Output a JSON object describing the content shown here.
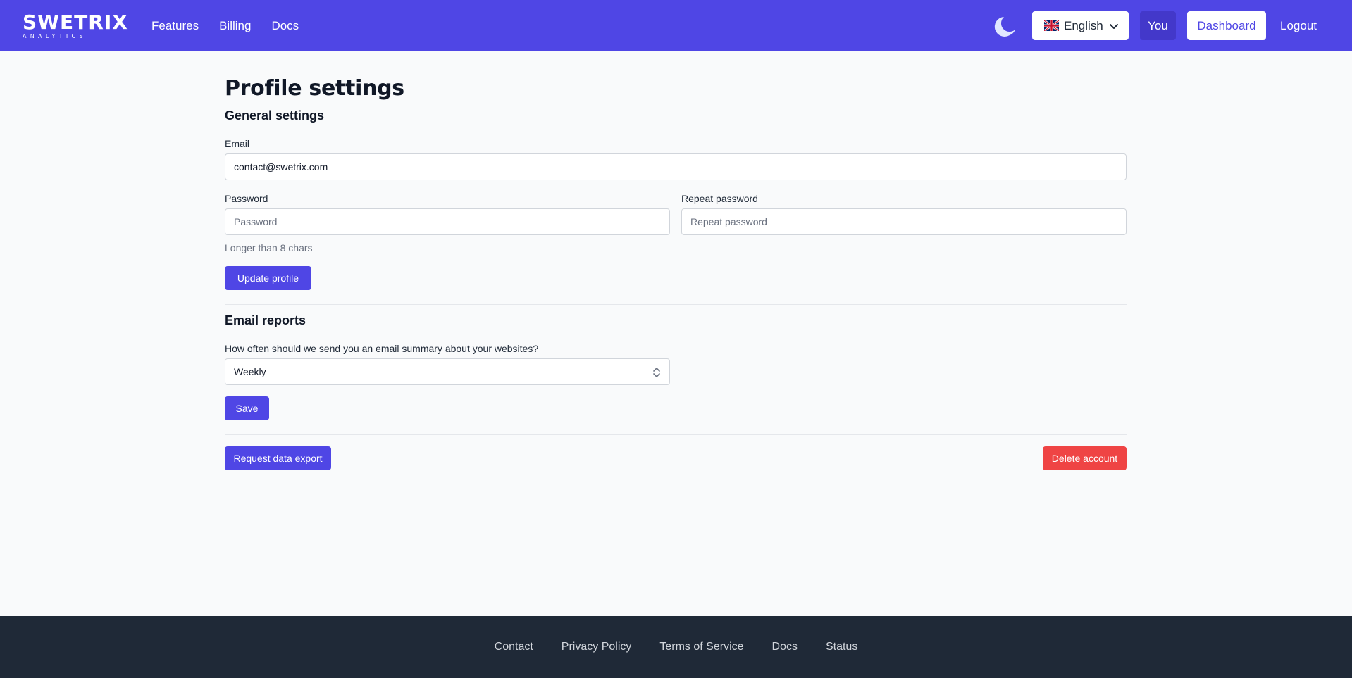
{
  "brand": {
    "name": "SWETRIX",
    "tagline": "ANALYTICS"
  },
  "header": {
    "nav": [
      {
        "label": "Features"
      },
      {
        "label": "Billing"
      },
      {
        "label": "Docs"
      }
    ],
    "language": {
      "selected": "English",
      "flag": "uk-flag-icon"
    },
    "you_label": "You",
    "dashboard_label": "Dashboard",
    "logout_label": "Logout",
    "theme_icon": "moon-icon"
  },
  "profile": {
    "title": "Profile settings",
    "general": {
      "title": "General settings",
      "email_label": "Email",
      "email_value": "contact@swetrix.com",
      "password_label": "Password",
      "password_placeholder": "Password",
      "repeat_label": "Repeat password",
      "repeat_placeholder": "Repeat password",
      "password_hint": "Longer than 8 chars",
      "update_button": "Update profile"
    },
    "reports": {
      "title": "Email reports",
      "question": "How often should we send you an email summary about your websites?",
      "selected": "Weekly",
      "save_button": "Save"
    },
    "export_button": "Request data export",
    "delete_button": "Delete account"
  },
  "footer": {
    "links": [
      {
        "label": "Contact"
      },
      {
        "label": "Privacy Policy"
      },
      {
        "label": "Terms of Service"
      },
      {
        "label": "Docs"
      },
      {
        "label": "Status"
      }
    ]
  },
  "colors": {
    "primary": "#4f46e5",
    "primary_dark": "#4338ca",
    "danger": "#ef4444",
    "footer_bg": "#1f2937",
    "page_bg": "#f9fafb"
  }
}
